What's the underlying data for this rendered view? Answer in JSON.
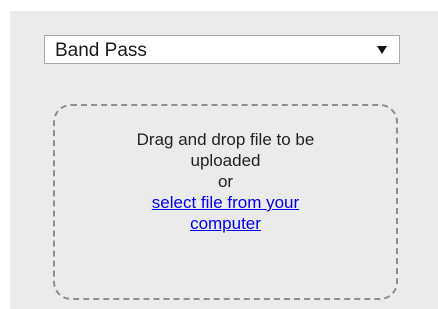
{
  "filter_select": {
    "value": "Band Pass"
  },
  "upload": {
    "line1": "Drag and drop file to be",
    "line2": "uploaded",
    "or": "or",
    "link_text": "select file from your computer"
  }
}
